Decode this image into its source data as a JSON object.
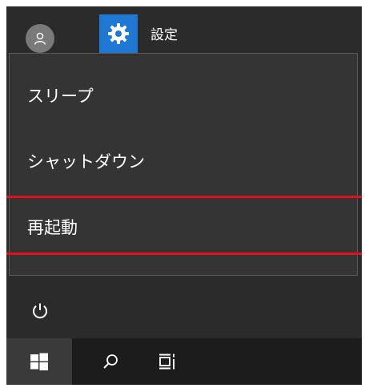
{
  "start_menu": {
    "settings_label": "設定",
    "icons": {
      "user": "user-avatar-icon",
      "settings": "gear-icon",
      "power": "power-icon"
    }
  },
  "power_menu": {
    "items": [
      {
        "label": "スリープ"
      },
      {
        "label": "シャットダウン"
      },
      {
        "label": "再起動"
      }
    ],
    "highlighted": "再起動"
  },
  "taskbar": {
    "icons": [
      "windows-logo-icon",
      "search-icon",
      "task-view-icon"
    ]
  },
  "colors": {
    "menu_background": "#343434",
    "start_background": "#2b2b2b",
    "taskbar_background": "#1c1c1c",
    "settings_tile": "#1e78d4",
    "highlight_border": "#e0101e",
    "text": "#ffffff"
  }
}
